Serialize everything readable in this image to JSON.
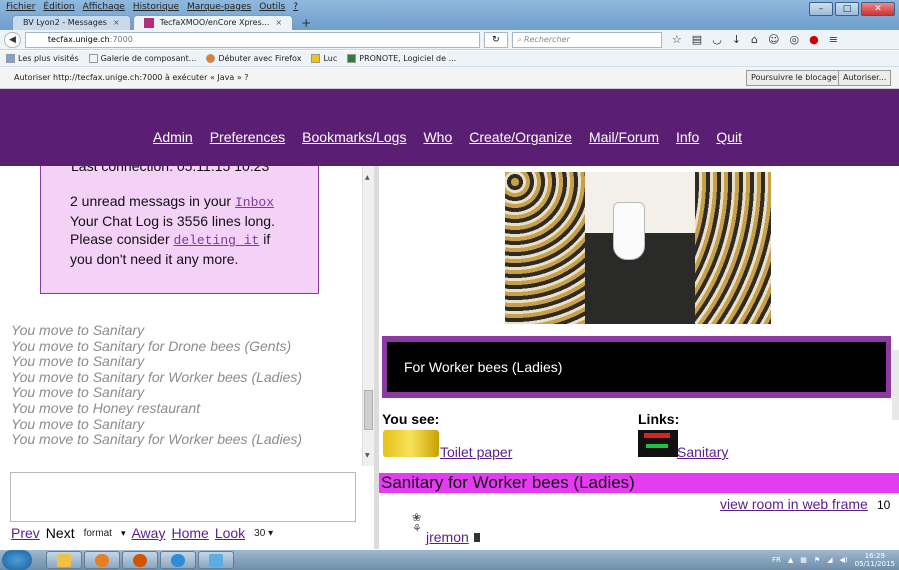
{
  "browser": {
    "menu": [
      "Fichier",
      "Édition",
      "Affichage",
      "Historique",
      "Marque-pages",
      "Outils",
      "?"
    ],
    "tabs": [
      {
        "label": "BV Lyon2 - Messages",
        "active": false
      },
      {
        "label": "TecfaXMOO/enCore Xpres...",
        "active": true
      }
    ],
    "url_host": "tecfax.unige.ch",
    "url_rest": ":7000",
    "search_placeholder": "Rechercher",
    "bookmarks": [
      "Les plus visités",
      "Galerie de composant...",
      "Débuter avec Firefox",
      "Luc",
      "PRONOTE, Logiciel de ..."
    ],
    "notification": {
      "text": "Autoriser http://tecfax.unige.ch:7000 à exécuter « Java » ?",
      "continue_label": "Poursuivre le blocage",
      "allow_label": "Autoriser..."
    }
  },
  "moo_nav": [
    "Admin",
    "Preferences",
    "Bookmarks/Logs",
    "Who",
    "Create/Organize",
    "Mail/Forum",
    "Info",
    "Quit"
  ],
  "messages": {
    "last_connection": "Last connection: 05.11.15 10:23",
    "unread_prefix": "2 unread messags in your",
    "inbox_link": "Inbox",
    "chatlog": "Your Chat Log is 3556 lines long.",
    "consider_prefix": "Please consider",
    "delete_link": "deleting it",
    "consider_suffix": "if",
    "need_line": "you don't need it any more."
  },
  "log_lines": [
    "You move to Sanitary",
    "You move to Sanitary for Drone bees (Gents)",
    "You move to Sanitary",
    "You move to Sanitary for Worker bees (Ladies)",
    "You move to Sanitary",
    "You move to Honey restaurant",
    "You move to Sanitary",
    "You move to Sanitary for Worker bees (Ladies)"
  ],
  "controls": {
    "prev": "Prev",
    "next": "Next",
    "format": "format",
    "away": "Away",
    "home": "Home",
    "look": "Look",
    "count": "30"
  },
  "room": {
    "banner": "For Worker bees (Ladies)",
    "you_see_label": "You see:",
    "links_label": "Links:",
    "item": "Toilet paper",
    "link": "Sanitary",
    "title": "Sanitary for Worker bees (Ladies)",
    "view_room": "view room in web frame",
    "page_num": "10",
    "user": "jremon"
  },
  "taskbar": {
    "lang": "FR",
    "time": "16:29",
    "date": "05/11/2015"
  }
}
